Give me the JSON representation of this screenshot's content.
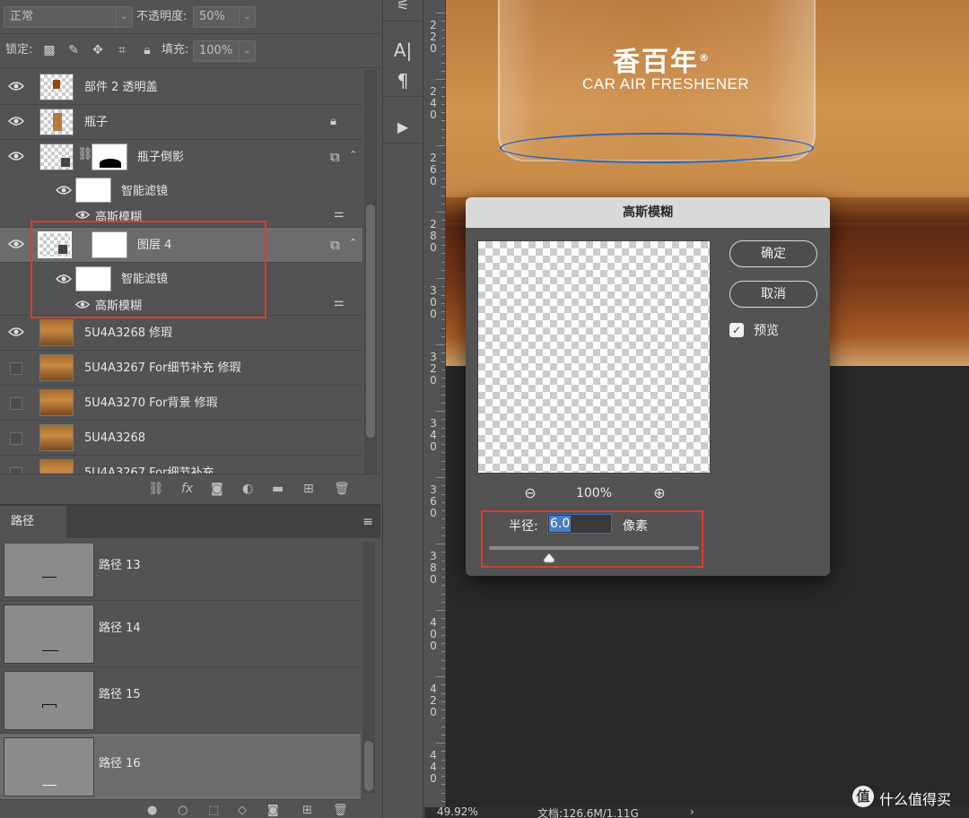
{
  "layers_panel": {
    "blend_mode": "正常",
    "opacity_label": "不透明度:",
    "opacity_value": "50%",
    "lock_label": "锁定:",
    "fill_label": "填充:",
    "fill_value": "100%",
    "layers": [
      {
        "name": "部件 2 透明盖",
        "visible": true
      },
      {
        "name": "瓶子",
        "visible": true,
        "locked": true
      },
      {
        "name": "瓶子倒影",
        "visible": true,
        "smart": true,
        "filter_label": "智能滤镜",
        "filter_name": "高斯模糊"
      },
      {
        "name": "图层 4",
        "visible": true,
        "selected": true,
        "smart": true,
        "filter_label": "智能滤镜",
        "filter_name": "高斯模糊"
      },
      {
        "name": "5U4A3268 修瑕",
        "visible": true
      },
      {
        "name": "5U4A3267 For细节补充 修瑕",
        "visible": false
      },
      {
        "name": "5U4A3270 For背景 修瑕",
        "visible": false
      },
      {
        "name": "5U4A3268",
        "visible": false
      },
      {
        "name": "5U4A3267 For细节补充",
        "visible": false
      }
    ]
  },
  "paths_panel": {
    "tab_label": "路径",
    "paths": [
      {
        "name": "路径 13"
      },
      {
        "name": "路径 14"
      },
      {
        "name": "路径 15"
      },
      {
        "name": "路径 16",
        "selected": true
      }
    ]
  },
  "ruler": {
    "labels": [
      "220",
      "240",
      "260",
      "280",
      "300",
      "320",
      "340",
      "360",
      "380",
      "400",
      "420",
      "440"
    ]
  },
  "canvas": {
    "brand_cn": "香百年",
    "brand_mark": "®",
    "brand_en": "CAR AIR FRESHENER"
  },
  "dialog": {
    "title": "高斯模糊",
    "ok_label": "确定",
    "cancel_label": "取消",
    "preview_label": "预览",
    "preview_checked": true,
    "zoom_value": "100%",
    "radius_label": "半径:",
    "radius_value": "6.0",
    "radius_unit": "像素"
  },
  "status_bar": {
    "zoom": "49.92%",
    "doc_info": "文档:126.6M/1.11G"
  },
  "watermark": {
    "text": "什么值得买",
    "icon_char": "值"
  },
  "colors": {
    "accent_red": "#e03a2f",
    "path_blue": "#2a63c9",
    "panel_bg": "#535353"
  }
}
